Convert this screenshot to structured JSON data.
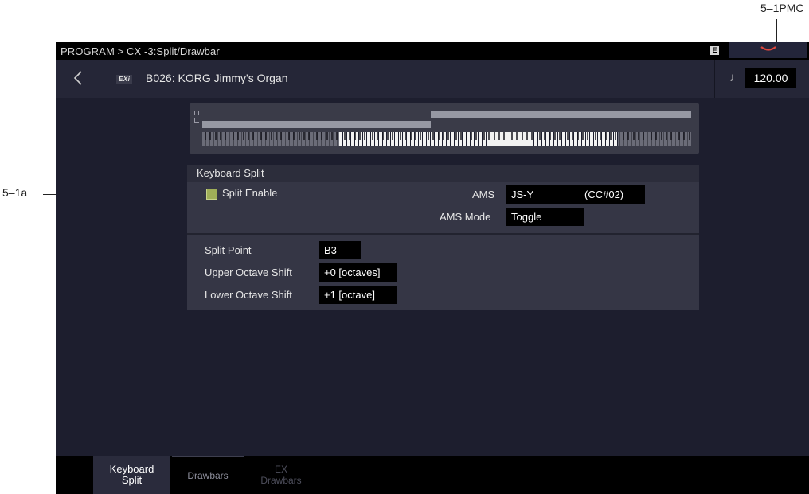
{
  "annotations": {
    "top_right": "5–1PMC",
    "left": "5–1a"
  },
  "topbar": {
    "breadcrumb": "PROGRAM > CX -3:Split/Drawbar",
    "e_badge": "E"
  },
  "header": {
    "back_icon": "chevron-left-icon",
    "engine_badge": "EXi",
    "program_name": "B026: KORG Jimmy's Organ",
    "tempo_icon": "quarter-note-icon",
    "tempo": "120.00"
  },
  "keyboard_split": {
    "title": "Keyboard Split",
    "split_enable_label": "Split Enable",
    "split_enable_checked": true,
    "ams_label": "AMS",
    "ams_value": "JS-Y",
    "ams_cc": "(CC#02)",
    "ams_mode_label": "AMS Mode",
    "ams_mode_value": "Toggle",
    "split_point_label": "Split Point",
    "split_point_value": "B3",
    "upper_shift_label": "Upper Octave Shift",
    "upper_shift_value": "+0 [octaves]",
    "lower_shift_label": "Lower Octave Shift",
    "lower_shift_value": "+1 [octave]"
  },
  "tabs": [
    {
      "line1": "Keyboard",
      "line2": "Split",
      "state": "active"
    },
    {
      "line1": "Drawbars",
      "line2": "",
      "state": "normal"
    },
    {
      "line1": "EX",
      "line2": "Drawbars",
      "state": "disabled"
    }
  ],
  "colors": {
    "screen_bg": "#1d1e2e",
    "panel_bg": "#353645",
    "checkbox": "#9fae58",
    "pmc_chevron": "#e0463c"
  }
}
